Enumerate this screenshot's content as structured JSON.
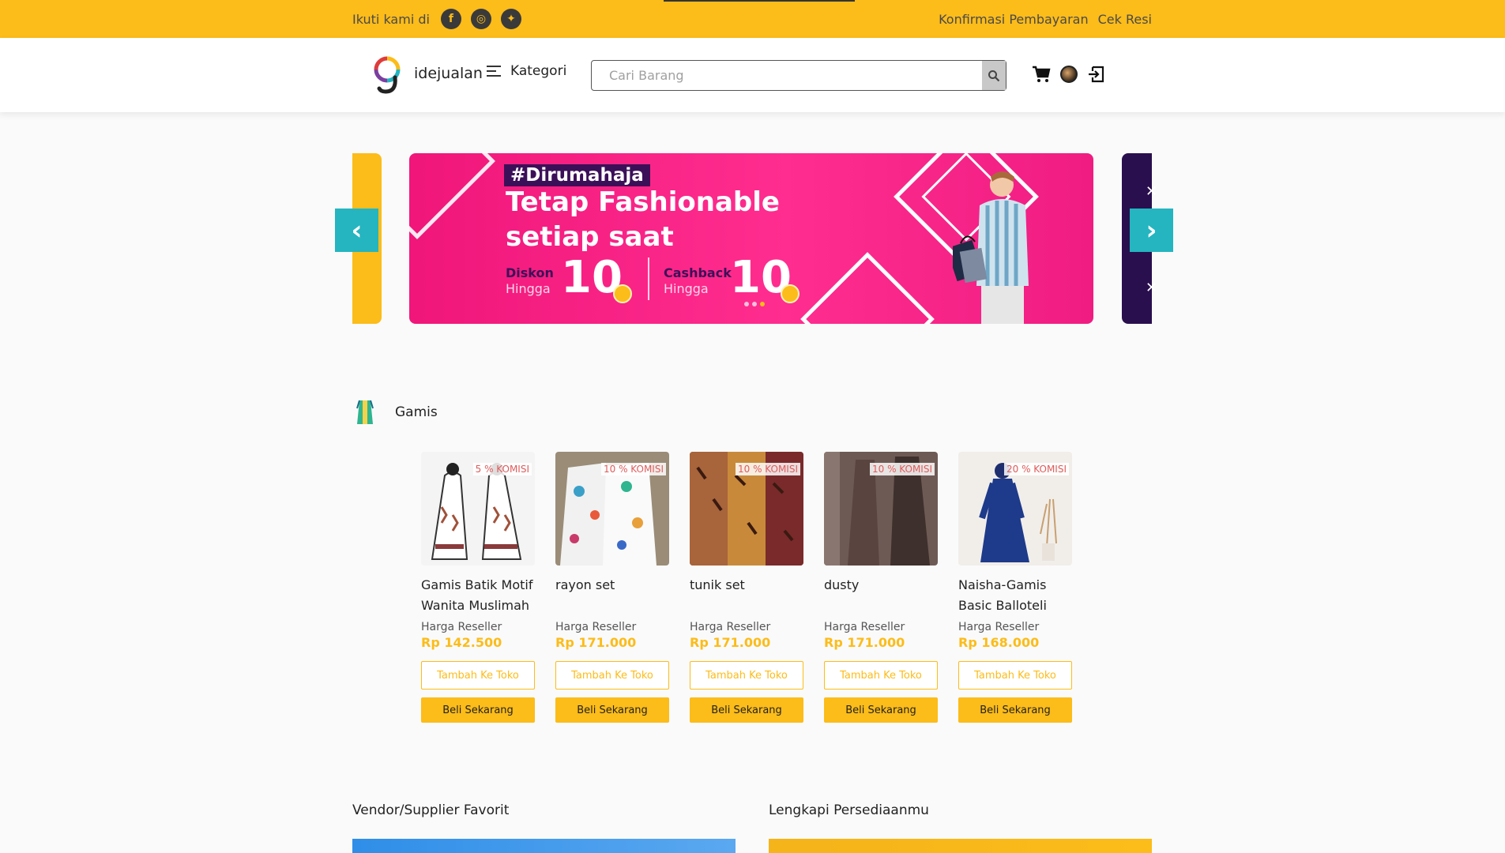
{
  "topbar": {
    "follow_text": "Ikuti kami di",
    "social": [
      {
        "name": "facebook-icon",
        "glyph": "f"
      },
      {
        "name": "instagram-icon",
        "glyph": "◎"
      },
      {
        "name": "twitter-icon",
        "glyph": "✦"
      }
    ],
    "links": [
      "Konfirmasi Pembayaran",
      "Cek Resi"
    ]
  },
  "header": {
    "brand": "idejualan",
    "kategori_label": "Kategori",
    "search_placeholder": "Cari Barang"
  },
  "banner": {
    "hashtag": "#Dirumahaja",
    "headline_1": "Tetap Fashionable",
    "headline_2": "setiap saat",
    "diskon_label": "Diskon",
    "diskon_sub": "Hingga",
    "diskon_value": "10",
    "cashback_label": "Cashback",
    "cashback_sub": "Hingga",
    "cashback_value": "10",
    "prev_glyph": "‹",
    "next_glyph": "›"
  },
  "category": {
    "title": "Gamis"
  },
  "products": [
    {
      "name": "Gamis Batik Motif Wanita Muslimah",
      "komisi": "5 % KOMISI",
      "label": "Harga Reseller",
      "price": "Rp 142.500",
      "add": "Tambah Ke Toko",
      "buy": "Beli Sekarang"
    },
    {
      "name": "rayon set",
      "komisi": "10 % KOMISI",
      "label": "Harga Reseller",
      "price": "Rp 171.000",
      "add": "Tambah Ke Toko",
      "buy": "Beli Sekarang"
    },
    {
      "name": "tunik set",
      "komisi": "10 % KOMISI",
      "label": "Harga Reseller",
      "price": "Rp 171.000",
      "add": "Tambah Ke Toko",
      "buy": "Beli Sekarang"
    },
    {
      "name": "dusty",
      "komisi": "10 % KOMISI",
      "label": "Harga Reseller",
      "price": "Rp 171.000",
      "add": "Tambah Ke Toko",
      "buy": "Beli Sekarang"
    },
    {
      "name": "Naisha-Gamis Basic Balloteli",
      "komisi": "20 % KOMISI",
      "label": "Harga Reseller",
      "price": "Rp 168.000",
      "add": "Tambah Ke Toko",
      "buy": "Beli Sekarang"
    }
  ],
  "sections": {
    "vendor_title": "Vendor/Supplier Favorit",
    "stock_title": "Lengkapi Persediaanmu"
  },
  "colors": {
    "accent": "#fcbc19",
    "nav_button": "#24b5c0",
    "banner": "#f0167a"
  }
}
